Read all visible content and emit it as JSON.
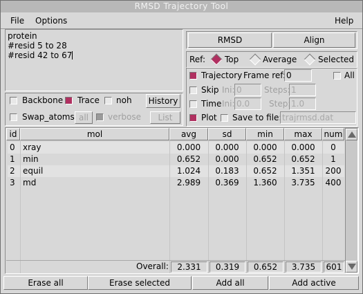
{
  "window": {
    "title": "RMSD Trajectory Tool"
  },
  "menu": {
    "file": "File",
    "options": "Options",
    "help": "Help"
  },
  "selection_text": [
    "protein",
    "#resid 5 to 28",
    "#resid 42 to 67"
  ],
  "buttons": {
    "rmsd": "RMSD",
    "align": "Align",
    "history": "History",
    "list": "List"
  },
  "ref": {
    "label": "Ref:",
    "options": [
      "Top",
      "Average",
      "Selected"
    ],
    "selected": "Top"
  },
  "options_left": {
    "backbone": {
      "label": "Backbone",
      "checked": false
    },
    "trace": {
      "label": "Trace",
      "checked": true
    },
    "noh": {
      "label": "noh",
      "checked": false
    },
    "swap_atoms": {
      "label": "Swap_atoms:",
      "checked": false
    },
    "swap_all": "all",
    "verbose": {
      "label": "verbose",
      "checked": true
    }
  },
  "trajectory": {
    "label": "Trajectory",
    "checked": true,
    "frame_ref_label": "Frame ref:",
    "frame_ref_value": "0",
    "all_label": "All",
    "all_checked": false,
    "skip_label": "Skip",
    "ini_label": "Ini:",
    "skip_ini": "0",
    "steps_label": "Steps:",
    "skip_steps": "1",
    "time_label": "Time",
    "time_ini": "0.0",
    "step_label": "Step:",
    "time_step": "1.0",
    "plot_label": "Plot",
    "plot_checked": true,
    "save_label": "Save to file:",
    "save_file": "trajrmsd.dat"
  },
  "table": {
    "columns": [
      "id",
      "mol",
      "avg",
      "sd",
      "min",
      "max",
      "num"
    ],
    "rows": [
      {
        "id": "0",
        "mol": "xray",
        "avg": "0.000",
        "sd": "0.000",
        "min": "0.000",
        "max": "0.000",
        "num": "0"
      },
      {
        "id": "1",
        "mol": "min",
        "avg": "0.652",
        "sd": "0.000",
        "min": "0.652",
        "max": "0.652",
        "num": "1"
      },
      {
        "id": "2",
        "mol": "equil",
        "avg": "1.024",
        "sd": "0.183",
        "min": "0.652",
        "max": "1.351",
        "num": "200"
      },
      {
        "id": "3",
        "mol": "md",
        "avg": "2.989",
        "sd": "0.369",
        "min": "1.360",
        "max": "3.735",
        "num": "400"
      }
    ],
    "overall": {
      "label": "Overall:",
      "avg": "2.331",
      "sd": "0.319",
      "min": "0.652",
      "max": "3.735",
      "num": "601"
    }
  },
  "bottom_buttons": [
    "Erase all",
    "Erase selected",
    "Add all",
    "Add active"
  ],
  "colors": {
    "accent": "#b03060",
    "background": "#d8d8d8",
    "title_bar": "#b8b8b8"
  }
}
